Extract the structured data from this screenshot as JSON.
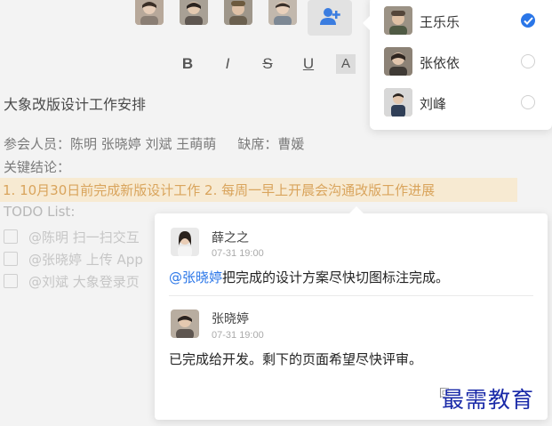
{
  "toolbar": {
    "bold": "B",
    "italic": "I",
    "strike": "S",
    "underline": "U",
    "font_color": "A"
  },
  "document": {
    "title": "大象改版设计工作安排",
    "attendees": "参会人员：陈明 张晓婷 刘斌 王萌萌",
    "absent": "缺席：曹媛",
    "key_conclusions_label": "关键结论：",
    "conclusions": "1. 10月30日前完成新版设计工作    2. 每周一早上开晨会沟通改版工作进展",
    "todo_label": "TODO List:",
    "todos": [
      "@陈明 扫一扫交互",
      "@张晓婷 上传 App",
      "@刘斌 大象登录页"
    ]
  },
  "member_picker": {
    "items": [
      {
        "name": "王乐乐",
        "selected": true
      },
      {
        "name": "张依依",
        "selected": false
      },
      {
        "name": "刘峰",
        "selected": false
      }
    ]
  },
  "comments": [
    {
      "author": "薛之之",
      "time": "07-31 19:00",
      "mention": "@张晓婷",
      "text": "把完成的设计方案尽快切图标注完成。"
    },
    {
      "author": "张晓婷",
      "time": "07-31 19:00",
      "text": "已完成给开发。剩下的页面希望尽快评审。"
    }
  ],
  "reply_stub": "回",
  "watermark": "最需教育",
  "colors": {
    "accent": "#2a76e8",
    "highlight_bg": "#f7ead2",
    "highlight_text": "#d9a45c"
  },
  "icons": {
    "add_member": "add-user-icon",
    "selected": "check-circle-icon"
  }
}
